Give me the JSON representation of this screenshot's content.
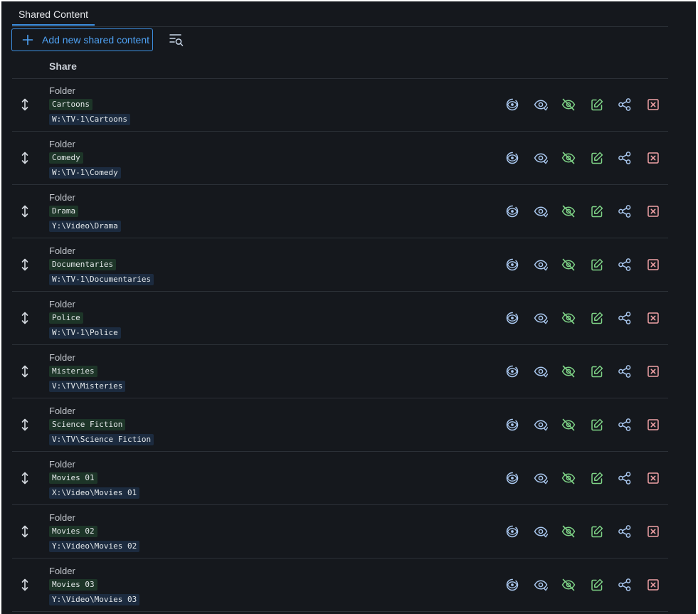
{
  "tabs": [
    {
      "label": "Shared Content"
    }
  ],
  "toolbar": {
    "add_label": "Add new shared content",
    "add_icon": "plus-icon",
    "filter_icon": "filter-search-icon"
  },
  "table": {
    "column_share": "Share",
    "rows": [
      {
        "type": "Folder",
        "name": "Cartoons",
        "path": "W:\\TV-1\\Cartoons"
      },
      {
        "type": "Folder",
        "name": "Comedy",
        "path": "W:\\TV-1\\Comedy"
      },
      {
        "type": "Folder",
        "name": "Drama",
        "path": "Y:\\Video\\Drama"
      },
      {
        "type": "Folder",
        "name": "Documentaries",
        "path": "W:\\TV-1\\Documentaries"
      },
      {
        "type": "Folder",
        "name": "Police",
        "path": "W:\\TV-1\\Police"
      },
      {
        "type": "Folder",
        "name": "Misteries",
        "path": "V:\\TV\\Misteries"
      },
      {
        "type": "Folder",
        "name": "Science Fiction",
        "path": "V:\\TV\\Science Fiction"
      },
      {
        "type": "Folder",
        "name": "Movies 01",
        "path": "X:\\Video\\Movies 01"
      },
      {
        "type": "Folder",
        "name": "Movies 02",
        "path": "Y:\\Video\\Movies 02"
      },
      {
        "type": "Folder",
        "name": "Movies 03",
        "path": "Y:\\Video\\Movies 03"
      }
    ],
    "row_actions": [
      "scan-icon",
      "view-icon",
      "hide-icon",
      "edit-icon",
      "share-icon",
      "delete-icon"
    ]
  },
  "colors": {
    "accent": "#3d8fe0",
    "icon_blue": "#a9c7ee",
    "icon_green": "#7ed386",
    "icon_red": "#f2a2a6",
    "name_tag_bg": "#1d3528",
    "path_tag_bg": "#1c2b3f"
  }
}
